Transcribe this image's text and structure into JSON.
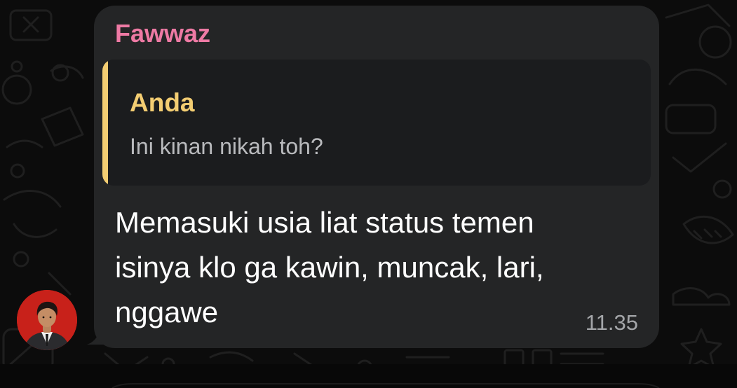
{
  "chat": {
    "message": {
      "sender_name": "Fawwaz",
      "reply": {
        "author": "Anda",
        "text": "Ini kinan nikah toh?"
      },
      "text_lines": [
        "Memasuki usia liat status temen",
        "isinya klo ga kawin, muncak, lari,",
        "nggawe"
      ],
      "time": "11.35"
    }
  },
  "colors": {
    "background": "#0c0c0c",
    "bubble": "#242526",
    "quote_background": "#1b1c1e",
    "sender_name": "#ee7aa4",
    "reply_accent": "#f3cd72",
    "message_text": "#ffffff",
    "time_text": "#a4a6a9"
  },
  "icons": {
    "avatar": "profile-photo-red-background"
  }
}
